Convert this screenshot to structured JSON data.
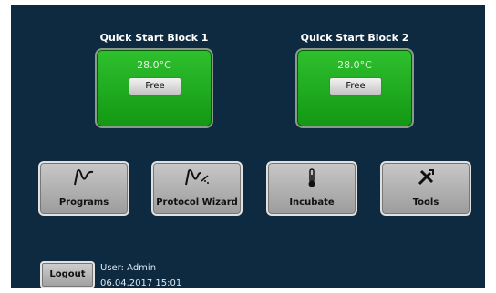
{
  "blocks": [
    {
      "title": "Quick Start Block 1",
      "temperature": "28.0°C",
      "button_label": "Free"
    },
    {
      "title": "Quick Start Block 2",
      "temperature": "28.0°C",
      "button_label": "Free"
    }
  ],
  "tiles": [
    {
      "label": "Programs",
      "icon": "programs-curve-icon"
    },
    {
      "label": "Protocol Wizard",
      "icon": "wizard-curve-icon"
    },
    {
      "label": "Incubate",
      "icon": "thermometer-icon"
    },
    {
      "label": "Tools",
      "icon": "tools-icon"
    }
  ],
  "footer": {
    "logout_label": "Logout",
    "user": "User: Admin",
    "datetime": "06.04.2017  15:01"
  },
  "colors": {
    "background": "#0e2a40",
    "block_green": "#22b022"
  }
}
